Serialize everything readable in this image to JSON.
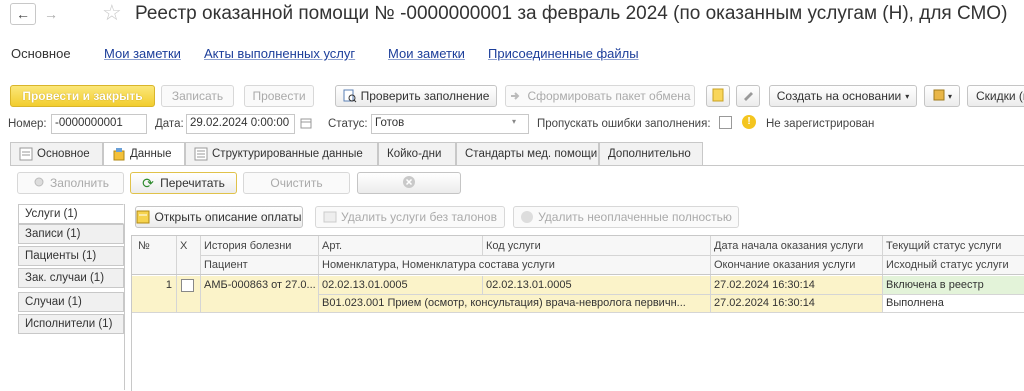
{
  "header": {
    "title": "Реестр оказанной помощи № -0000000001 за февраль 2024 (по оказанным услугам (Н), для СМО)",
    "back_glyph": "←",
    "forward_glyph": "→",
    "star_glyph": "☆"
  },
  "section_tabs": [
    "Основное",
    "Мои заметки",
    "Акты выполненных услуг",
    "Мои заметки",
    "Присоединенные файлы"
  ],
  "toolbar": {
    "post_close": "Провести и закрыть",
    "save": "Записать",
    "post": "Провести",
    "check": "Проверить заполнение",
    "form_packet": "Сформировать пакет обмена",
    "create_based": "Создать на основании",
    "discounts": "Скидки (к"
  },
  "form": {
    "number_label": "Номер:",
    "number_value": "-0000000001",
    "date_label": "Дата:",
    "date_value": "29.02.2024  0:00:00",
    "status_label": "Статус:",
    "status_value": "Готов",
    "skip_errors_label": "Пропускать ошибки заполнения:",
    "registration_status": "Не зарегистрирован"
  },
  "doc_tabs": [
    "Основное",
    "Данные",
    "Структурированные данные",
    "Койко-дни",
    "Стандарты мед. помощи",
    "Дополнительно"
  ],
  "data_toolbar": {
    "fill": "Заполнить",
    "reread": "Перечитать",
    "clear": "Очистить"
  },
  "side_tabs": [
    "Услуги (1)",
    "Записи (1)",
    "Пациенты (1)",
    "Зак. случаи (1)",
    "Случаи (1)",
    "Исполнители (1)"
  ],
  "grid_toolbar": {
    "open_payment": "Открыть описание оплаты",
    "delete_no_tickets": "Удалить услуги без талонов",
    "delete_unpaid": "Удалить неоплаченные полностью"
  },
  "grid": {
    "headers_row1": [
      "№",
      "X",
      "История болезни",
      "Арт.",
      "Код услуги",
      "Дата начала оказания услуги",
      "Текущий статус услуги"
    ],
    "headers_row2": [
      "",
      "",
      "Пациент",
      "Номенклатура, Номенклатура состава услуги",
      "",
      "Окончание оказания услуги",
      "Исходный статус услуги"
    ],
    "rows": [
      {
        "num": "1",
        "history": "АМБ-000863 от 27.0...",
        "art": "02.02.13.01.0005",
        "code": "02.02.13.01.0005",
        "start": "27.02.2024 16:30:14",
        "status": "Включена в реестр",
        "patient": "",
        "nomenclature": "В01.023.001 Прием (осмотр, консультация) врача-невролога первичн...",
        "end": "27.02.2024 16:30:14",
        "orig_status": "Выполнена"
      }
    ]
  },
  "colors": {
    "accent": "#f2cd2e",
    "row_highlight": "#fbf3c9",
    "status_green": "#e3f3d9",
    "link": "#1c3e9a"
  }
}
